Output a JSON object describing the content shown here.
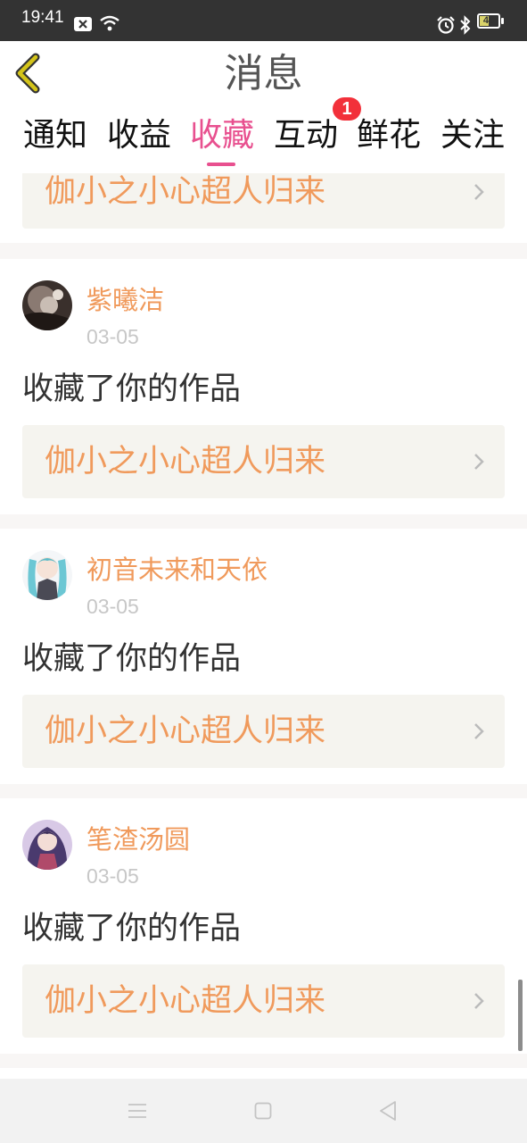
{
  "status_bar": {
    "time": "19:41",
    "battery": "46",
    "icons": [
      "notification-icon",
      "wifi-icon",
      "alarm-icon",
      "bluetooth-icon",
      "battery-icon"
    ]
  },
  "header": {
    "title": "消息",
    "back_icon": "chevron-left-icon",
    "accent_color": "#d4c41a"
  },
  "tabs": [
    {
      "label": "通知"
    },
    {
      "label": "收益"
    },
    {
      "label": "收藏",
      "active": true
    },
    {
      "label": "互动",
      "badge": "1"
    },
    {
      "label": "鲜花"
    },
    {
      "label": "关注"
    }
  ],
  "theme": {
    "active_tab_color": "#e8508f",
    "username_color": "#f09a5c",
    "badge_color": "#f2303a"
  },
  "partial_card": {
    "work_title": "伽小之小心超人归来"
  },
  "notifications": [
    {
      "username": "紫曦洁",
      "date": "03-05",
      "action": "收藏了你的作品",
      "work_title": "伽小之小心超人归来"
    },
    {
      "username": "初音未来和天依",
      "date": "03-05",
      "action": "收藏了你的作品",
      "work_title": "伽小之小心超人归来"
    },
    {
      "username": "笔渣汤圆",
      "date": "03-05",
      "action": "收藏了你的作品",
      "work_title": "伽小之小心超人归来"
    }
  ],
  "nav_bar": {
    "icons": [
      "menu-icon",
      "home-square-icon",
      "back-triangle-icon"
    ]
  }
}
